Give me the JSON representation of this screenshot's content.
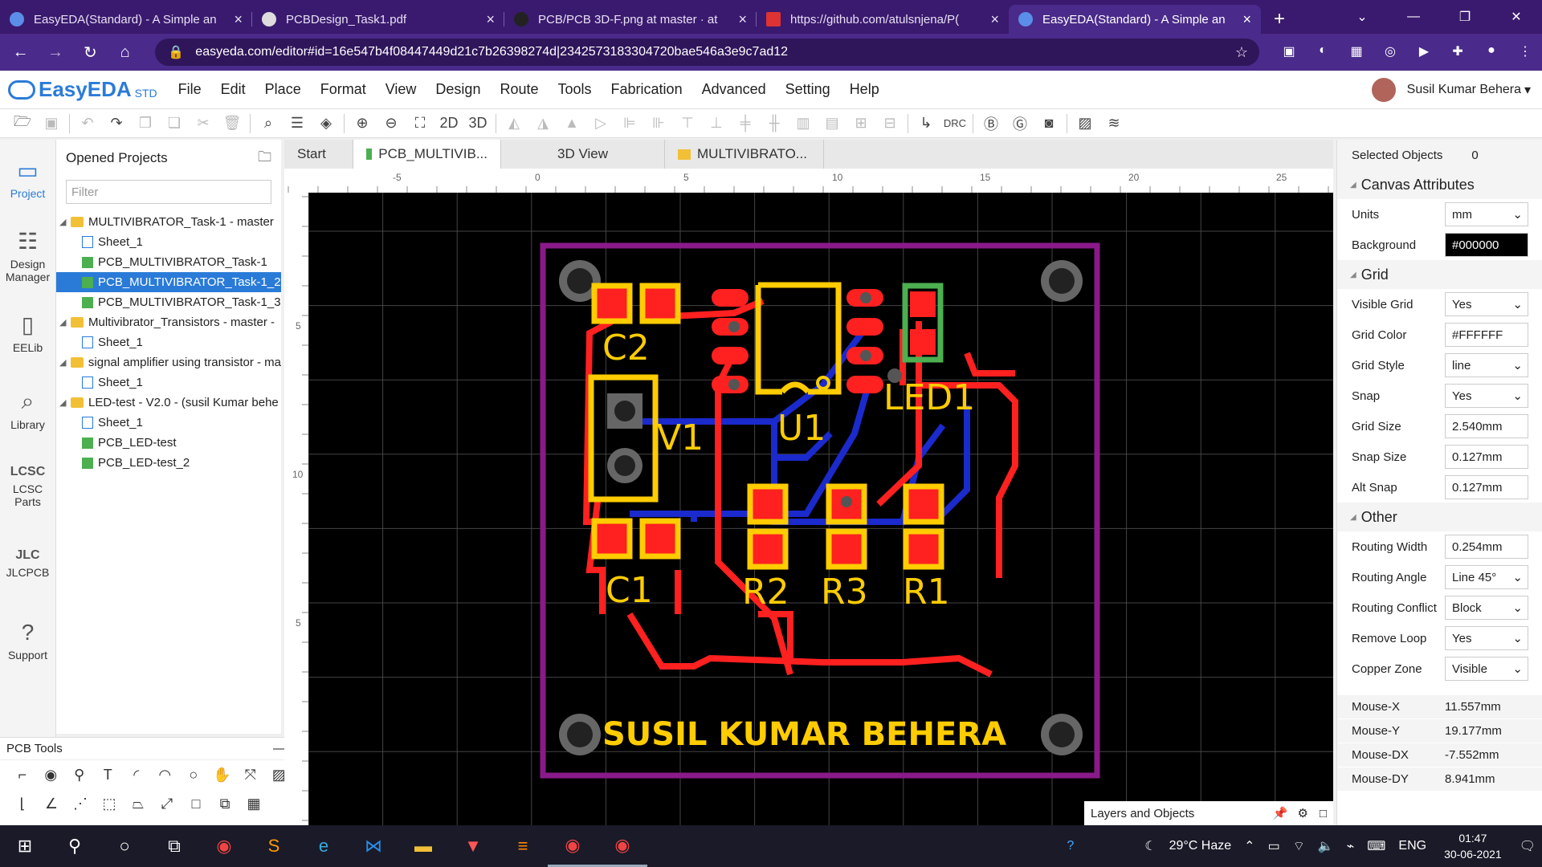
{
  "browser": {
    "tabs": [
      {
        "title": "EasyEDA(Standard) - A Simple an",
        "active": false
      },
      {
        "title": "PCBDesign_Task1.pdf",
        "active": false
      },
      {
        "title": "PCB/PCB 3D-F.png at master · at",
        "active": false
      },
      {
        "title": "https://github.com/atulsnjena/P(",
        "active": false
      },
      {
        "title": "EasyEDA(Standard) - A Simple an",
        "active": true
      }
    ],
    "url": "easyeda.com/editor#id=16e547b4f08447449d21c7b26398274d|2342573183304720bae546a3e9c7ad12"
  },
  "app": {
    "logo": "EasyEDA",
    "logo_sub": "STD",
    "menus": [
      "File",
      "Edit",
      "Place",
      "Format",
      "View",
      "Design",
      "Route",
      "Tools",
      "Fabrication",
      "Advanced",
      "Setting",
      "Help"
    ],
    "user": "Susil Kumar Behera"
  },
  "toolbar": {
    "btn_2d": "2D",
    "btn_3d": "3D",
    "btn_drc": "DRC"
  },
  "left_nav": [
    {
      "label": "Project",
      "icon": "project-icon"
    },
    {
      "label": "Design Manager",
      "icon": "design-manager-icon"
    },
    {
      "label": "EELib",
      "icon": "eelib-icon"
    },
    {
      "label": "Library",
      "icon": "library-icon"
    },
    {
      "label": "LCSC Parts",
      "icon": "lcsc-icon"
    },
    {
      "label": "JLCPCB",
      "icon": "jlcpcb-icon"
    },
    {
      "label": "Support",
      "icon": "support-icon"
    }
  ],
  "project_panel": {
    "title": "Opened Projects",
    "filter_placeholder": "Filter",
    "items": [
      {
        "label": "MULTIVIBRATOR_Task-1 - master",
        "type": "folder",
        "level": 0
      },
      {
        "label": "Sheet_1",
        "type": "sheet",
        "level": 1
      },
      {
        "label": "PCB_MULTIVIBRATOR_Task-1",
        "type": "pcb",
        "level": 1
      },
      {
        "label": "PCB_MULTIVIBRATOR_Task-1_2",
        "type": "pcb",
        "level": 1,
        "selected": true
      },
      {
        "label": "PCB_MULTIVIBRATOR_Task-1_3",
        "type": "pcb",
        "level": 1
      },
      {
        "label": "Multivibrator_Transistors - master -",
        "type": "folder",
        "level": 0
      },
      {
        "label": "Sheet_1",
        "type": "sheet",
        "level": 1
      },
      {
        "label": "signal amplifier using transistor - ma",
        "type": "folder",
        "level": 0
      },
      {
        "label": "Sheet_1",
        "type": "sheet",
        "level": 1
      },
      {
        "label": "LED-test - V2.0 - (susil Kumar behe",
        "type": "folder",
        "level": 0
      },
      {
        "label": "Sheet_1",
        "type": "sheet",
        "level": 1
      },
      {
        "label": "PCB_LED-test",
        "type": "pcb",
        "level": 1
      },
      {
        "label": "PCB_LED-test_2",
        "type": "pcb",
        "level": 1
      }
    ]
  },
  "pcb_tools": {
    "title": "PCB Tools"
  },
  "doc_tabs": [
    {
      "label": "Start",
      "type": "plain"
    },
    {
      "label": "PCB_MULTIVIB...",
      "type": "pcb",
      "active": true
    },
    {
      "label": "3D View",
      "type": "plain"
    },
    {
      "label": "MULTIVIBRATO...",
      "type": "folder"
    }
  ],
  "ruler": {
    "h_ticks": [
      "-5",
      "0",
      "5",
      "10",
      "15",
      "20",
      "25"
    ],
    "v_ticks": [
      "5",
      "10",
      "5"
    ]
  },
  "pcb": {
    "labels": {
      "c2": "C2",
      "c1": "C1",
      "v1": "V1",
      "u1": "U1",
      "led1": "LED1",
      "r2": "R2",
      "r3": "R3",
      "r1": "R1",
      "signature": "SUSIL KUMAR BEHERA"
    },
    "colors": {
      "outline": "#8a1a8a",
      "silk": "#ffcc00",
      "top": "#ff2020",
      "bottom": "#1a2acc",
      "background": "#000000"
    }
  },
  "layers_objects": "Layers and Objects",
  "right_panel": {
    "selected_label": "Selected Objects",
    "selected_count": "0",
    "canvas_section": "Canvas Attributes",
    "canvas_rows": [
      {
        "label": "Units",
        "value": "mm",
        "dropdown": true
      },
      {
        "label": "Background",
        "value": "#000000",
        "dark": true
      }
    ],
    "grid_section": "Grid",
    "grid_rows": [
      {
        "label": "Visible Grid",
        "value": "Yes",
        "dropdown": true
      },
      {
        "label": "Grid Color",
        "value": "#FFFFFF"
      },
      {
        "label": "Grid Style",
        "value": "line",
        "dropdown": true
      },
      {
        "label": "Snap",
        "value": "Yes",
        "dropdown": true
      },
      {
        "label": "Grid Size",
        "value": "2.540mm"
      },
      {
        "label": "Snap Size",
        "value": "0.127mm"
      },
      {
        "label": "Alt Snap",
        "value": "0.127mm"
      }
    ],
    "other_section": "Other",
    "other_rows": [
      {
        "label": "Routing Width",
        "value": "0.254mm"
      },
      {
        "label": "Routing Angle",
        "value": "Line 45°",
        "dropdown": true
      },
      {
        "label": "Routing Conflict",
        "value": "Block",
        "dropdown": true
      },
      {
        "label": "Remove Loop",
        "value": "Yes",
        "dropdown": true
      },
      {
        "label": "Copper Zone",
        "value": "Visible",
        "dropdown": true
      }
    ],
    "mouse_rows": [
      {
        "label": "Mouse-X",
        "value": "11.557mm"
      },
      {
        "label": "Mouse-Y",
        "value": "19.177mm"
      },
      {
        "label": "Mouse-DX",
        "value": "-7.552mm"
      },
      {
        "label": "Mouse-DY",
        "value": "8.941mm"
      }
    ]
  },
  "taskbar": {
    "weather": "29°C  Haze",
    "lang": "ENG",
    "time": "01:47",
    "date": "30-06-2021"
  }
}
